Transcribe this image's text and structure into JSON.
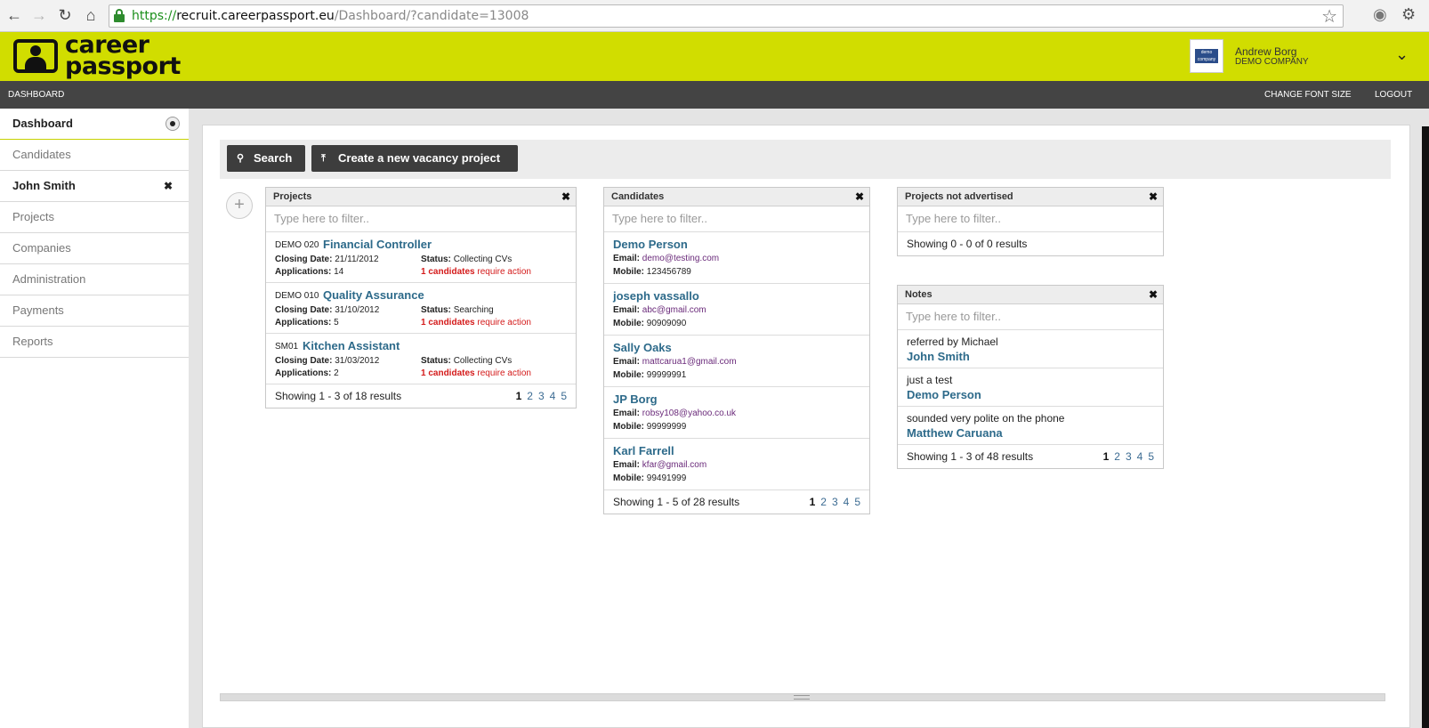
{
  "browser": {
    "url_scheme": "https://",
    "url_host": "recruit.careerpassport.eu",
    "url_path": "/Dashboard/?candidate=13008"
  },
  "header": {
    "logo_line1": "career",
    "logo_line2": "passport",
    "user_name": "Andrew Borg",
    "user_company": "DEMO COMPANY",
    "avatar_text": "demo company ltd."
  },
  "topnav": {
    "dashboard": "DASHBOARD",
    "change_font": "CHANGE FONT SIZE",
    "logout": "LOGOUT"
  },
  "sidebar": {
    "items": [
      {
        "label": "Dashboard"
      },
      {
        "label": "Candidates"
      },
      {
        "label": "John Smith"
      },
      {
        "label": "Projects"
      },
      {
        "label": "Companies"
      },
      {
        "label": "Administration"
      },
      {
        "label": "Payments"
      },
      {
        "label": "Reports"
      }
    ]
  },
  "toolbar": {
    "search_label": "Search",
    "create_label": "Create a new vacancy project"
  },
  "projects": {
    "title": "Projects",
    "filter_placeholder": "Type here to filter..",
    "closing_label": "Closing Date:",
    "applications_label": "Applications:",
    "status_label": "Status:",
    "req_label": "require action",
    "rows": [
      {
        "code": "DEMO 020",
        "title": "Financial Controller",
        "closing": "21/11/2012",
        "applications": "14",
        "status": "Collecting CVs",
        "req_count": "1 candidates"
      },
      {
        "code": "DEMO 010",
        "title": "Quality Assurance",
        "closing": "31/10/2012",
        "applications": "5",
        "status": "Searching",
        "req_count": "1 candidates"
      },
      {
        "code": "SM01",
        "title": "Kitchen Assistant",
        "closing": "31/03/2012",
        "applications": "2",
        "status": "Collecting CVs",
        "req_count": "1 candidates"
      }
    ],
    "footer": "Showing 1 - 3 of 18 results",
    "pages": [
      "1",
      "2",
      "3",
      "4",
      "5"
    ]
  },
  "candidates": {
    "title": "Candidates",
    "filter_placeholder": "Type here to filter..",
    "email_label": "Email:",
    "mobile_label": "Mobile:",
    "rows": [
      {
        "name": "Demo Person",
        "email": "demo@testing.com",
        "mobile": "123456789"
      },
      {
        "name": "joseph vassallo",
        "email": "abc@gmail.com",
        "mobile": "90909090"
      },
      {
        "name": "Sally Oaks",
        "email": "mattcarua1@gmail.com",
        "mobile": "99999991"
      },
      {
        "name": "JP Borg",
        "email": "robsy108@yahoo.co.uk",
        "mobile": "99999999"
      },
      {
        "name": "Karl Farrell",
        "email": "kfar@gmail.com",
        "mobile": "99491999"
      }
    ],
    "footer": "Showing 1 - 5 of 28 results",
    "pages": [
      "1",
      "2",
      "3",
      "4",
      "5"
    ]
  },
  "not_advertised": {
    "title": "Projects not advertised",
    "filter_placeholder": "Type here to filter..",
    "footer": "Showing 0 - 0 of 0 results"
  },
  "notes": {
    "title": "Notes",
    "filter_placeholder": "Type here to filter..",
    "rows": [
      {
        "text": "referred by Michael",
        "name": "John Smith"
      },
      {
        "text": "just a test",
        "name": "Demo Person"
      },
      {
        "text": "sounded very polite on the phone",
        "name": "Matthew Caruana"
      }
    ],
    "footer": "Showing 1 - 3 of 48 results",
    "pages": [
      "1",
      "2",
      "3",
      "4",
      "5"
    ]
  },
  "colors": {
    "brand_lime": "#d1dd00",
    "nav_dark": "#444444",
    "link_blue": "#2d6a8a",
    "alert_red": "#d41b1b"
  }
}
